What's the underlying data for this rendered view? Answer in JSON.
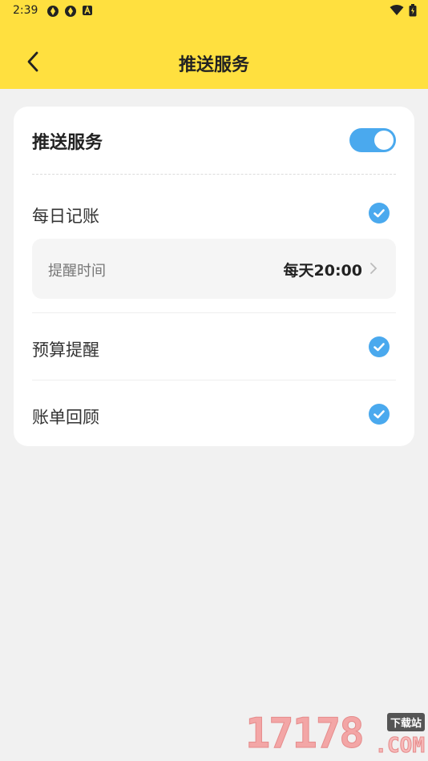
{
  "status_bar": {
    "time": "2:39",
    "left_icons": [
      "app-notification-icon",
      "app-notification-icon",
      "a-icon"
    ],
    "right_icons": [
      "wifi-icon",
      "battery-icon"
    ]
  },
  "nav": {
    "title": "推送服务",
    "back_icon": "chevron-left-icon"
  },
  "push_service": {
    "label": "推送服务",
    "enabled": true
  },
  "options": [
    {
      "label": "每日记账",
      "checked": true
    },
    {
      "label": "预算提醒",
      "checked": true
    },
    {
      "label": "账单回顾",
      "checked": true
    }
  ],
  "reminder": {
    "label": "提醒时间",
    "value": "每天20:00"
  },
  "watermark": {
    "digits": "17178",
    "tag": "下载站",
    "suffix": ".COM"
  },
  "colors": {
    "header": "#ffe03f",
    "accent": "#4aa9ee",
    "background": "#f1f1f1"
  }
}
